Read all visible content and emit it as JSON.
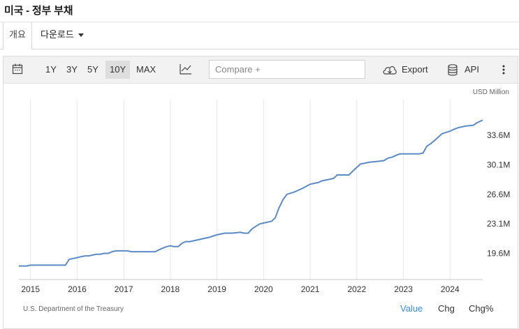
{
  "page": {
    "title": "미국 - 정부 부채"
  },
  "tabs": {
    "overview": "개요",
    "download": "다운로드"
  },
  "toolbar": {
    "ranges": [
      "1Y",
      "3Y",
      "5Y",
      "10Y",
      "MAX"
    ],
    "selected_range": "10Y",
    "compare_placeholder": "Compare +",
    "export_label": "Export",
    "api_label": "API"
  },
  "chart_data": {
    "type": "line",
    "unit_label": "USD Million",
    "x_ticks": [
      "2015",
      "2016",
      "2017",
      "2018",
      "2019",
      "2020",
      "2021",
      "2022",
      "2023",
      "2024"
    ],
    "y_ticks": [
      "19.6M",
      "23.1M",
      "26.6M",
      "30.1M",
      "33.6M"
    ],
    "y_tick_values": [
      19.6,
      23.1,
      26.6,
      30.1,
      33.6
    ],
    "xlim": [
      2014.75,
      2024.7
    ],
    "ylim": [
      16.5,
      37.5
    ],
    "grid": "vertical",
    "line_color": "#5b8ac5",
    "series": [
      {
        "x": [
          2014.75,
          2014.92,
          2015.0,
          2015.08,
          2015.25,
          2015.5,
          2015.75,
          2015.83,
          2015.92,
          2016.0,
          2016.08,
          2016.17,
          2016.25,
          2016.33,
          2016.42,
          2016.5,
          2016.58,
          2016.67,
          2016.75,
          2016.83,
          2016.92,
          2017.0,
          2017.08,
          2017.17,
          2017.25,
          2017.33,
          2017.5,
          2017.67,
          2017.83,
          2017.92,
          2018.0,
          2018.08,
          2018.17,
          2018.25,
          2018.33,
          2018.42,
          2018.5,
          2018.67,
          2018.83,
          2019.0,
          2019.17,
          2019.33,
          2019.5,
          2019.58,
          2019.67,
          2019.75,
          2019.83,
          2019.92,
          2020.0,
          2020.08,
          2020.17,
          2020.25,
          2020.33,
          2020.42,
          2020.5,
          2020.67,
          2020.83,
          2021.0,
          2021.17,
          2021.25,
          2021.42,
          2021.5,
          2021.58,
          2021.75,
          2021.83,
          2021.92,
          2022.0,
          2022.08,
          2022.17,
          2022.25,
          2022.42,
          2022.58,
          2022.67,
          2022.75,
          2022.83,
          2022.92,
          2023.0,
          2023.17,
          2023.33,
          2023.42,
          2023.5,
          2023.58,
          2023.67,
          2023.75,
          2023.83,
          2024.0,
          2024.08,
          2024.17,
          2024.33,
          2024.5,
          2024.58,
          2024.7
        ],
        "y": [
          18.1,
          18.1,
          18.2,
          18.2,
          18.2,
          18.2,
          18.2,
          18.9,
          19.0,
          19.1,
          19.2,
          19.3,
          19.3,
          19.4,
          19.5,
          19.5,
          19.6,
          19.6,
          19.8,
          19.9,
          19.9,
          19.9,
          19.9,
          19.8,
          19.8,
          19.8,
          19.8,
          19.8,
          20.2,
          20.4,
          20.5,
          20.4,
          20.4,
          20.8,
          21.0,
          21.0,
          21.1,
          21.3,
          21.5,
          21.8,
          22.0,
          22.0,
          22.1,
          22.0,
          22.0,
          22.5,
          22.8,
          23.1,
          23.2,
          23.3,
          23.4,
          23.8,
          25.0,
          26.0,
          26.6,
          26.9,
          27.3,
          27.8,
          28.0,
          28.2,
          28.4,
          28.5,
          28.9,
          28.9,
          28.9,
          29.4,
          29.8,
          30.2,
          30.3,
          30.4,
          30.5,
          30.6,
          30.9,
          31.0,
          31.2,
          31.4,
          31.4,
          31.4,
          31.4,
          31.5,
          32.3,
          32.6,
          33.0,
          33.4,
          33.8,
          34.1,
          34.3,
          34.5,
          34.7,
          34.8,
          35.1,
          35.4
        ]
      }
    ]
  },
  "footer": {
    "source": "U.S. Department of the Treasury",
    "modes": [
      "Value",
      "Chg",
      "Chg%"
    ],
    "selected_mode": "Value"
  }
}
